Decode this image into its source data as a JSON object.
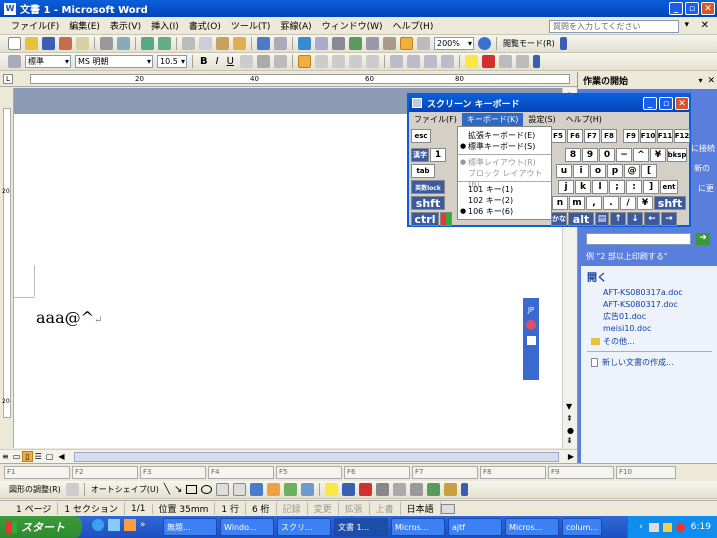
{
  "window": {
    "title": "文書 1 - Microsoft Word"
  },
  "menu": [
    "ファイル(F)",
    "編集(E)",
    "表示(V)",
    "挿入(I)",
    "書式(O)",
    "ツール(T)",
    "罫線(A)",
    "ウィンドウ(W)",
    "ヘルプ(H)"
  ],
  "help_box": {
    "placeholder": "質問を入力してください"
  },
  "toolbar": {
    "zoom": "200%",
    "reading_mode": "閲覧モード(R)",
    "style": "標準",
    "font": "MS 明朝",
    "size": "10.5",
    "bold": "B",
    "italic": "I",
    "underline": "U"
  },
  "ruler": {
    "marks": [
      "20",
      "40",
      "60",
      "80"
    ]
  },
  "vruler": {
    "marks": [
      "20",
      "20"
    ]
  },
  "document": {
    "text": "aaa@^"
  },
  "task_pane": {
    "title": "作業の開始",
    "partial_text": [
      "に接続",
      "新の",
      "に更"
    ],
    "example": "例 \"2 部以上印刷する\"",
    "open_heading": "開く",
    "files": [
      "AFT-KS080317a.doc",
      "AFT-KS080317.doc",
      "広告01.doc",
      "meisi10.doc"
    ],
    "other": "その他...",
    "new_doc": "新しい文書の作成..."
  },
  "osk": {
    "title": "スクリーン キーボード",
    "menu": [
      "ファイル(F)",
      "キーボード(K)",
      "設定(S)",
      "ヘルプ(H)"
    ],
    "dropdown": {
      "items": [
        {
          "label": "拡張キーボード(E)",
          "state": "normal"
        },
        {
          "label": "標準キーボード(S)",
          "state": "selected"
        },
        {
          "label": "標準レイアウト(R)",
          "state": "disabled"
        },
        {
          "label": "ブロック レイアウト(B)",
          "state": "disabled"
        },
        {
          "label": "101 キー(1)",
          "state": "normal"
        },
        {
          "label": "102 キー(2)",
          "state": "normal"
        },
        {
          "label": "106 キー(6)",
          "state": "selected"
        }
      ]
    },
    "rows": [
      [
        "esc",
        "F5",
        "F6",
        "F7",
        "F8",
        "F9",
        "F10",
        "F11",
        "F12"
      ],
      [
        "漢字",
        "1",
        "8",
        "9",
        "0",
        "−",
        "^",
        "¥",
        "bksp"
      ],
      [
        "tab",
        "u",
        "i",
        "o",
        "p",
        "@",
        "["
      ],
      [
        "英数lock",
        "j",
        "k",
        "l",
        ";",
        ":",
        "]",
        "ent"
      ],
      [
        "shft",
        "n",
        "m",
        ",",
        ".",
        "/",
        "¥",
        "shft"
      ],
      [
        "ctrl",
        "かな",
        "alt",
        "↑",
        "↓",
        "←",
        "→"
      ]
    ]
  },
  "langbar": {
    "label": "JP"
  },
  "fkeys": [
    "F1",
    "F2",
    "F3",
    "F4",
    "F5",
    "F6",
    "F7",
    "F8",
    "F9",
    "F10"
  ],
  "drawbar": {
    "draw": "図形の調整(R)",
    "autoshape": "オートシェイプ(U)"
  },
  "status": [
    "1 ページ",
    "1 セクション",
    "1/1",
    "位置 35mm",
    "1 行",
    "6 桁",
    "記録",
    "変更",
    "拡張",
    "上書",
    "日本語"
  ],
  "taskbar": {
    "start": "スタート",
    "items": [
      "無題...",
      "Windo...",
      "スクリ...",
      "文書 1...",
      "Micros...",
      "ajtf",
      "Micros...",
      "colum..."
    ],
    "clock": "6:19"
  }
}
